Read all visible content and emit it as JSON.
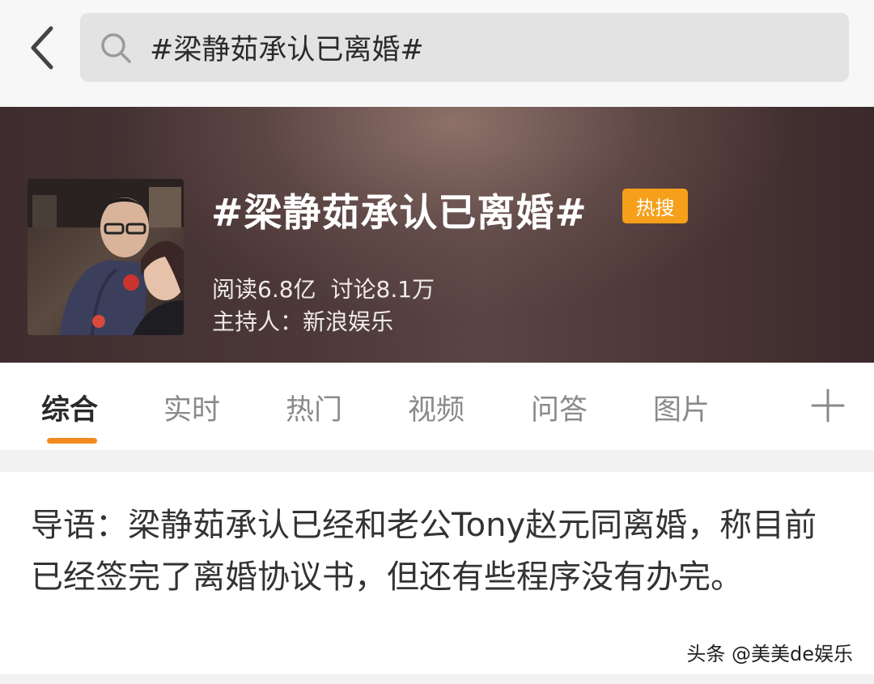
{
  "search": {
    "query": "#梁静茹承认已离婚#"
  },
  "topic": {
    "title": "#梁静茹承认已离婚#",
    "badge": "热搜",
    "reads": "阅读6.8亿",
    "discussions": "讨论8.1万",
    "host": "主持人：新浪娱乐"
  },
  "tabs": [
    {
      "label": "综合"
    },
    {
      "label": "实时"
    },
    {
      "label": "热门"
    },
    {
      "label": "视频"
    },
    {
      "label": "问答"
    },
    {
      "label": "图片"
    }
  ],
  "lead": {
    "text": "导语：梁静茹承认已经和老公Tony赵元同离婚，称目前已经签完了离婚协议书，但还有些程序没有办完。"
  },
  "watermark": "头条 @美美de娱乐",
  "colors": {
    "accent": "#f28a1e",
    "badge": "#f59f1a"
  },
  "icons": {
    "back": "chevron-left-icon",
    "search": "search-icon",
    "add": "plus-icon"
  }
}
